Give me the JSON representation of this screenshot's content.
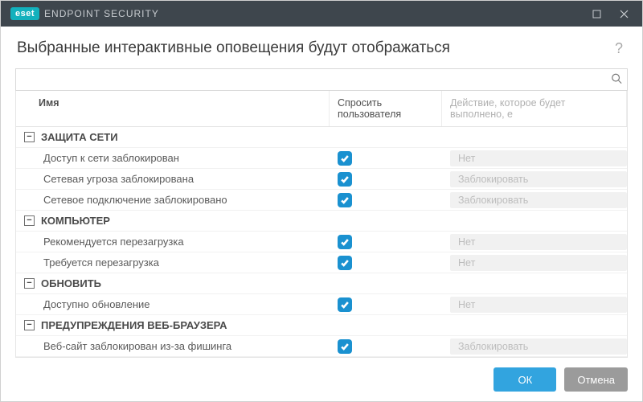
{
  "brand": {
    "badge": "eset",
    "product": "ENDPOINT SECURITY"
  },
  "heading": "Выбранные интерактивные оповещения будут отображаться",
  "columns": {
    "name": "Имя",
    "ask": "Спросить пользователя",
    "action": "Действие, которое будет выполнено, е"
  },
  "groups": [
    {
      "title": "ЗАЩИТА СЕТИ",
      "items": [
        {
          "label": "Доступ к сети заблокирован",
          "ask": true,
          "action": "Нет"
        },
        {
          "label": "Сетевая угроза заблокирована",
          "ask": true,
          "action": "Заблокировать"
        },
        {
          "label": "Сетевое подключение заблокировано",
          "ask": true,
          "action": "Заблокировать"
        }
      ]
    },
    {
      "title": "КОМПЬЮТЕР",
      "items": [
        {
          "label": "Рекомендуется перезагрузка",
          "ask": true,
          "action": "Нет"
        },
        {
          "label": "Требуется перезагрузка",
          "ask": true,
          "action": "Нет"
        }
      ]
    },
    {
      "title": "ОБНОВИТЬ",
      "items": [
        {
          "label": "Доступно обновление",
          "ask": true,
          "action": "Нет"
        }
      ]
    },
    {
      "title": "ПРЕДУПРЕЖДЕНИЯ ВЕБ-БРАУЗЕРА",
      "items": [
        {
          "label": "Веб-сайт заблокирован из-за фишинга",
          "ask": true,
          "action": "Заблокировать"
        }
      ]
    }
  ],
  "buttons": {
    "ok": "ОК",
    "cancel": "Отмена"
  },
  "glyphs": {
    "minus": "−"
  }
}
